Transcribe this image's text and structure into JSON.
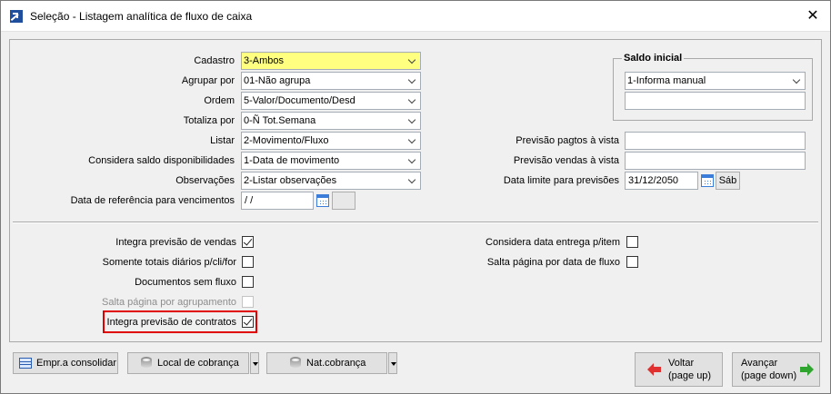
{
  "window": {
    "title": "Seleção - Listagem analítica de fluxo de caixa",
    "close_glyph": "✕"
  },
  "form": {
    "cadastro": {
      "label": "Cadastro",
      "value": "3-Ambos"
    },
    "agrupar": {
      "label": "Agrupar por",
      "value": "01-Não agrupa"
    },
    "ordem": {
      "label": "Ordem",
      "value": "5-Valor/Documento/Desd"
    },
    "totaliza": {
      "label": "Totaliza por",
      "value": "0-Ñ Tot.Semana"
    },
    "listar": {
      "label": "Listar",
      "value": "2-Movimento/Fluxo"
    },
    "saldo_disp": {
      "label": "Considera saldo disponibilidades",
      "value": "1-Data de movimento"
    },
    "observacoes": {
      "label": "Observações",
      "value": "2-Listar observações"
    },
    "data_ref": {
      "label": "Data de referência para vencimentos",
      "value": " / /"
    }
  },
  "saldo_inicial": {
    "title": "Saldo inicial",
    "select_value": "1-Informa manual",
    "input_value": ""
  },
  "previsao": {
    "pagtos": {
      "label": "Previsão pagtos à vista",
      "value": ""
    },
    "vendas": {
      "label": "Previsão vendas à vista",
      "value": ""
    },
    "data_limite": {
      "label": "Data limite para previsões",
      "value": "31/12/2050",
      "day": "Sáb"
    }
  },
  "checkboxes": {
    "integra_vendas": {
      "label": "Integra previsão de vendas",
      "checked": true
    },
    "somente_totais": {
      "label": "Somente totais diários p/cli/for",
      "checked": false
    },
    "docs_sem_fluxo": {
      "label": "Documentos sem fluxo",
      "checked": false
    },
    "salta_agrup": {
      "label": "Salta página por agrupamento",
      "checked": false,
      "disabled": true
    },
    "integra_contratos": {
      "label": "Integra previsão de contratos",
      "checked": true
    },
    "considera_entrega": {
      "label": "Considera data entrega p/item",
      "checked": false
    },
    "salta_fluxo": {
      "label": "Salta página por data de fluxo",
      "checked": false
    }
  },
  "buttons": {
    "empr": "Empr.a consolidar",
    "local_cobranca": "Local de cobrança",
    "nat_cobranca": "Nat.cobrança",
    "voltar_1": "Voltar",
    "voltar_2": "(page up)",
    "avancar_1": "Avançar",
    "avancar_2": "(page down)"
  },
  "colors": {
    "highlight": "#e00000",
    "required_field": "#ffff80",
    "back_arrow": "#e03030",
    "next_arrow": "#2fa52f"
  }
}
